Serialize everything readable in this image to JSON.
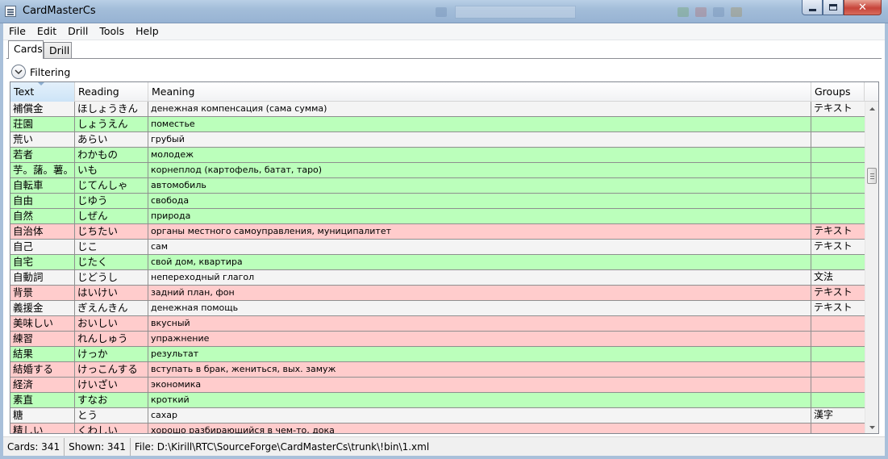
{
  "window": {
    "title": "CardMasterCs"
  },
  "menu": {
    "items": [
      "File",
      "Edit",
      "Drill",
      "Tools",
      "Help"
    ]
  },
  "tabs": [
    {
      "label": "Cards",
      "selected": true
    },
    {
      "label": "Drill",
      "selected": false
    }
  ],
  "filter": {
    "label": "Filtering"
  },
  "grid": {
    "columns": [
      "Text",
      "Reading",
      "Meaning",
      "Groups"
    ],
    "sorted_column": "Text",
    "status_colors": {
      "known": "#bbffbb",
      "wrong": "#ffcccc",
      "neutral": "#f4f4f4"
    },
    "rows": [
      {
        "text": "補償金",
        "reading": "ほしょうきん",
        "meaning": "денежная компенсация (сама сумма)",
        "groups": "テキスト",
        "status": "neutral"
      },
      {
        "text": "荘園",
        "reading": "しょうえん",
        "meaning": "поместье",
        "groups": "",
        "status": "known"
      },
      {
        "text": "荒い",
        "reading": "あらい",
        "meaning": "грубый",
        "groups": "",
        "status": "neutral"
      },
      {
        "text": "若者",
        "reading": "わかもの",
        "meaning": "молодеж",
        "groups": "",
        "status": "known"
      },
      {
        "text": "芋。藷。薯。",
        "reading": "いも",
        "meaning": "корнеплод (картофель, батат, таро)",
        "groups": "",
        "status": "known"
      },
      {
        "text": "自転車",
        "reading": "じてんしゃ",
        "meaning": "автомобиль",
        "groups": "",
        "status": "known"
      },
      {
        "text": "自由",
        "reading": "じゆう",
        "meaning": "свобода",
        "groups": "",
        "status": "known"
      },
      {
        "text": "自然",
        "reading": "しぜん",
        "meaning": "природа",
        "groups": "",
        "status": "known"
      },
      {
        "text": "自治体",
        "reading": "じちたい",
        "meaning": "органы местного самоуправления, муниципалитет",
        "groups": "テキスト",
        "status": "wrong"
      },
      {
        "text": "自己",
        "reading": "じこ",
        "meaning": "сам",
        "groups": "テキスト",
        "status": "neutral"
      },
      {
        "text": "自宅",
        "reading": "じたく",
        "meaning": "свой дом, квартира",
        "groups": "",
        "status": "known"
      },
      {
        "text": "自動詞",
        "reading": "じどうし",
        "meaning": "непереходный глагол",
        "groups": "文法",
        "status": "neutral"
      },
      {
        "text": "背景",
        "reading": "はいけい",
        "meaning": "задний план, фон",
        "groups": "テキスト",
        "status": "wrong"
      },
      {
        "text": "義援金",
        "reading": "ぎえんきん",
        "meaning": "денежная помощь",
        "groups": "テキスト",
        "status": "neutral"
      },
      {
        "text": "美味しい",
        "reading": "おいしい",
        "meaning": "вкусный",
        "groups": "",
        "status": "wrong"
      },
      {
        "text": "練習",
        "reading": "れんしゅう",
        "meaning": "упражнение",
        "groups": "",
        "status": "wrong"
      },
      {
        "text": "結果",
        "reading": "けっか",
        "meaning": "результат",
        "groups": "",
        "status": "known"
      },
      {
        "text": "結婚する",
        "reading": "けっこんする",
        "meaning": "вступать в брак, жениться, вых. замуж",
        "groups": "",
        "status": "wrong"
      },
      {
        "text": "経済",
        "reading": "けいざい",
        "meaning": "экономика",
        "groups": "",
        "status": "wrong"
      },
      {
        "text": "素直",
        "reading": "すなお",
        "meaning": "кроткий",
        "groups": "",
        "status": "known"
      },
      {
        "text": "糖",
        "reading": "とう",
        "meaning": "сахар",
        "groups": "漢字",
        "status": "neutral"
      },
      {
        "text": "精しい",
        "reading": "くわしい",
        "meaning": "хорошо разбирающийся в чем-то, дока",
        "groups": "",
        "status": "wrong"
      }
    ]
  },
  "status": {
    "cards": "Cards: 341",
    "shown": "Shown: 341",
    "file": "File: D:\\Kirill\\RTC\\SourceForge\\CardMasterCs\\trunk\\!bin\\1.xml"
  },
  "icons": {
    "app": "app-icon",
    "minimize": "minimize-icon",
    "maximize": "maximize-icon",
    "close": "close-icon",
    "expander": "chevron-down-icon"
  }
}
